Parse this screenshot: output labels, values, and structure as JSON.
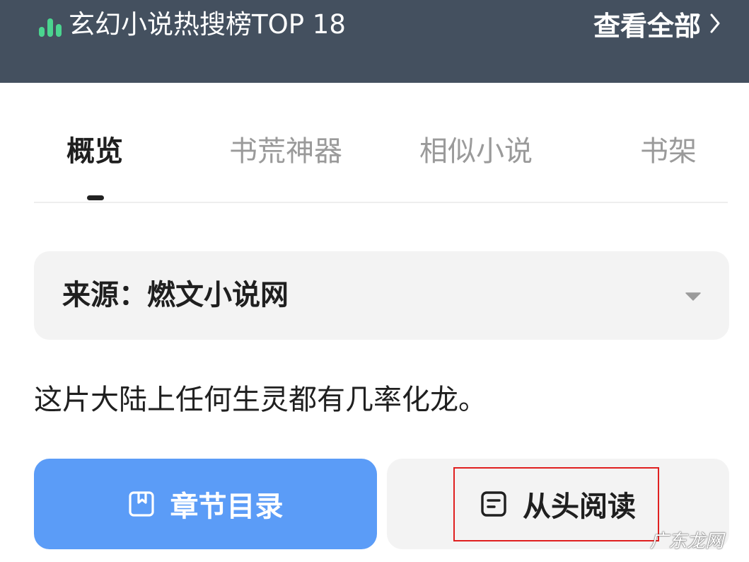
{
  "header": {
    "title": "玄幻小说热搜榜TOP 18",
    "view_all": "查看全部",
    "rank_icon": "bar-chart-icon",
    "accent_color": "#4bd48f",
    "background_color": "#44505f"
  },
  "tabs": [
    {
      "label": "概览",
      "active": true
    },
    {
      "label": "书荒神器",
      "active": false
    },
    {
      "label": "相似小说",
      "active": false
    },
    {
      "label": "书架",
      "active": false
    }
  ],
  "source": {
    "label": "来源：燃文小说网",
    "dropdown_icon": "caret-down-icon"
  },
  "description": "这片大陆上任何生灵都有几率化龙。",
  "buttons": {
    "toc": {
      "label": "章节目录",
      "icon": "bookmark-icon",
      "color": "#5b9cf7"
    },
    "read": {
      "label": "从头阅读",
      "icon": "document-icon"
    }
  },
  "watermark": "广东龙网"
}
